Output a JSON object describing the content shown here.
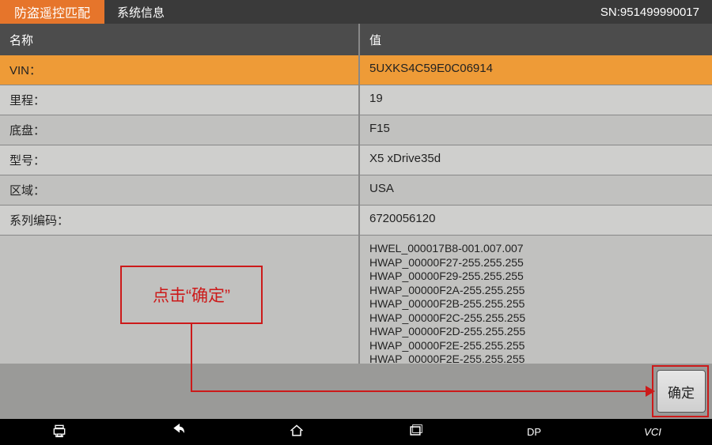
{
  "header": {
    "title": "防盗遥控匹配",
    "subtitle": "系统信息",
    "sn_label": "SN:951499990017"
  },
  "columns": {
    "name": "名称",
    "value": "值"
  },
  "rows": [
    {
      "name": "VIN：",
      "value": "5UXKS4C59E0C06914",
      "style": "highlight"
    },
    {
      "name": "里程：",
      "value": "19",
      "style": "A"
    },
    {
      "name": "底盘：",
      "value": "F15",
      "style": "B"
    },
    {
      "name": "型号：",
      "value": "X5 xDrive35d",
      "style": "A"
    },
    {
      "name": "区域：",
      "value": "USA",
      "style": "B"
    },
    {
      "name": "系列编码：",
      "value": "6720056120",
      "style": "A"
    },
    {
      "name": "",
      "value": "HWEL_000017B8-001.007.007\nHWAP_00000F27-255.255.255\nHWAP_00000F29-255.255.255\nHWAP_00000F2A-255.255.255\nHWAP_00000F2B-255.255.255\nHWAP_00000F2C-255.255.255\nHWAP_00000F2D-255.255.255\nHWAP_00000F2E-255.255.255\nHWAP_00000F2E-255.255.255",
      "style": "multi"
    }
  ],
  "ok_button": "确定",
  "callout_text": "点击“确定”",
  "nav": {
    "dp": "DP",
    "vci": "VCI"
  }
}
